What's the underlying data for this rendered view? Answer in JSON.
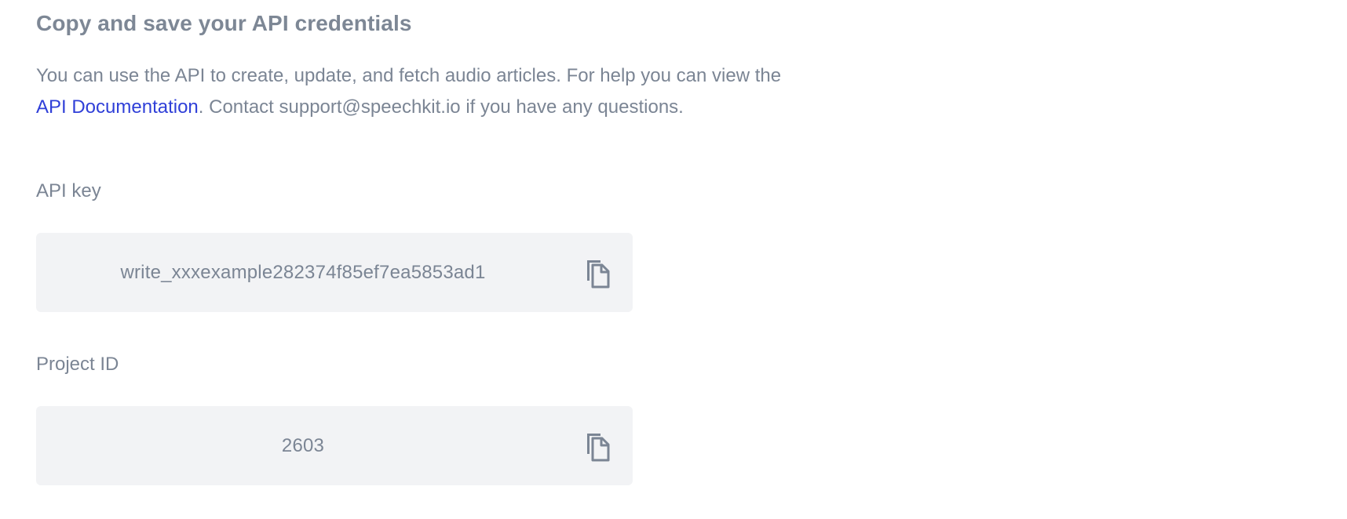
{
  "header": {
    "title": "Copy and save your API credentials"
  },
  "description": {
    "text_before_link": "You can use the API to create, update, and fetch audio articles. For help you can view the ",
    "link_text": "API Documentation",
    "text_after_link": ". Contact support@speechkit.io if you have any questions."
  },
  "api_key": {
    "label": "API key",
    "value": "write_xxxexample282374f85ef7ea5853ad1",
    "copy_icon": "copy-icon"
  },
  "project_id": {
    "label": "Project ID",
    "value": "2603",
    "copy_icon": "copy-icon"
  },
  "colors": {
    "link": "#2f3fd8",
    "text": "#7b8594",
    "field_background": "#f2f3f5"
  }
}
